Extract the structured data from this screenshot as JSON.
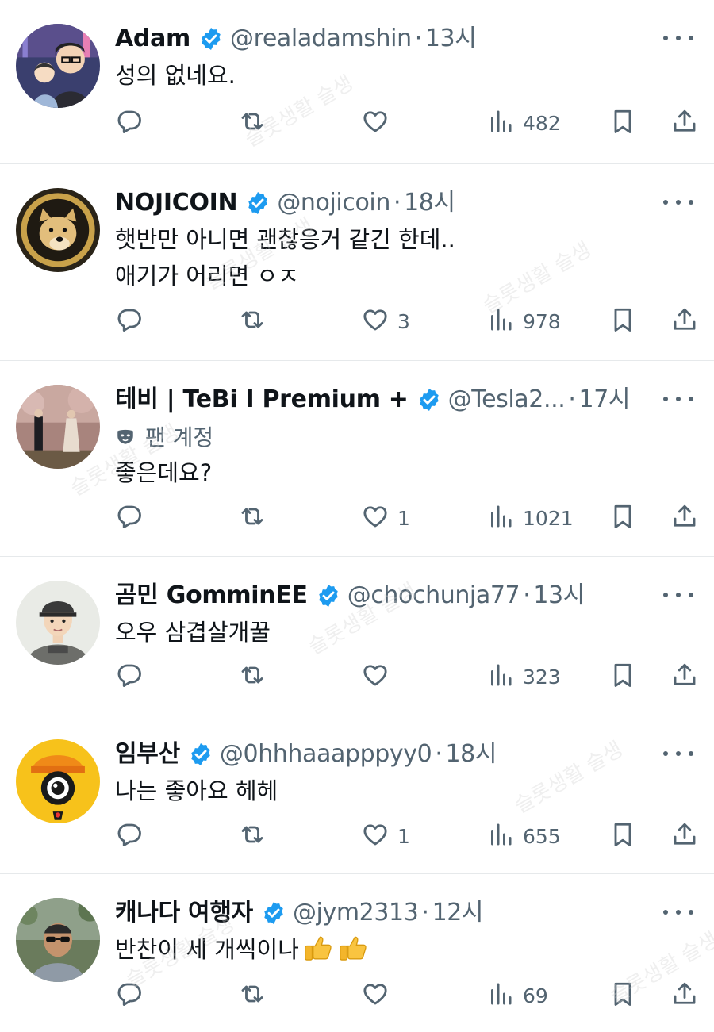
{
  "tweets": [
    {
      "name": "Adam",
      "verified": true,
      "handle": "@realadamshin",
      "time": "13시",
      "fan_label": "",
      "text": "성의 없네요.",
      "replies": "",
      "retweets": "",
      "likes": "",
      "views": "482",
      "avatar": "cartoon-family-avatar"
    },
    {
      "name": "NOJICOIN",
      "verified": true,
      "handle": "@nojicoin",
      "time": "18시",
      "fan_label": "",
      "text": "햇반만 아니면 괜찮응거 같긴 한데..\n애기가 어리면 ㅇㅈ",
      "replies": "",
      "retweets": "",
      "likes": "3",
      "views": "978",
      "avatar": "doge-coin-avatar"
    },
    {
      "name": "테비 | TeBi I Premium +",
      "verified": true,
      "handle": "@Tesla2...",
      "time": "17시",
      "fan_label": "팬 계정",
      "text": "좋은데요?",
      "replies": "",
      "retweets": "",
      "likes": "1",
      "views": "1021",
      "avatar": "couple-photo-avatar"
    },
    {
      "name": "곰민 GomminEE",
      "verified": true,
      "handle": "@chochunja77",
      "time": "13시",
      "fan_label": "",
      "text": "오우 삼겹살개꿀",
      "replies": "",
      "retweets": "",
      "likes": "",
      "views": "323",
      "avatar": "cartoon-man-cap-avatar"
    },
    {
      "name": "임부산",
      "verified": true,
      "handle": "@0hhhaaapppyy0",
      "time": "18시",
      "fan_label": "",
      "text": "나는 좋아요 헤헤",
      "replies": "",
      "retweets": "",
      "likes": "1",
      "views": "655",
      "avatar": "yellow-character-avatar"
    },
    {
      "name": "캐나다 여행자",
      "verified": true,
      "handle": "@jym2313",
      "time": "12시",
      "fan_label": "",
      "text": "반찬이 세 개씩이나",
      "text_emoji": [
        "thumbs-up-icon",
        "thumbs-up-icon"
      ],
      "replies": "",
      "retweets": "",
      "likes": "",
      "views": "69",
      "avatar": "man-sunglasses-avatar"
    }
  ],
  "watermark": "슬롯생활 슬생",
  "colors": {
    "verified": "#1d9bf0",
    "meta": "#536471",
    "text": "#0f1419",
    "divider": "#e6e9eb"
  }
}
